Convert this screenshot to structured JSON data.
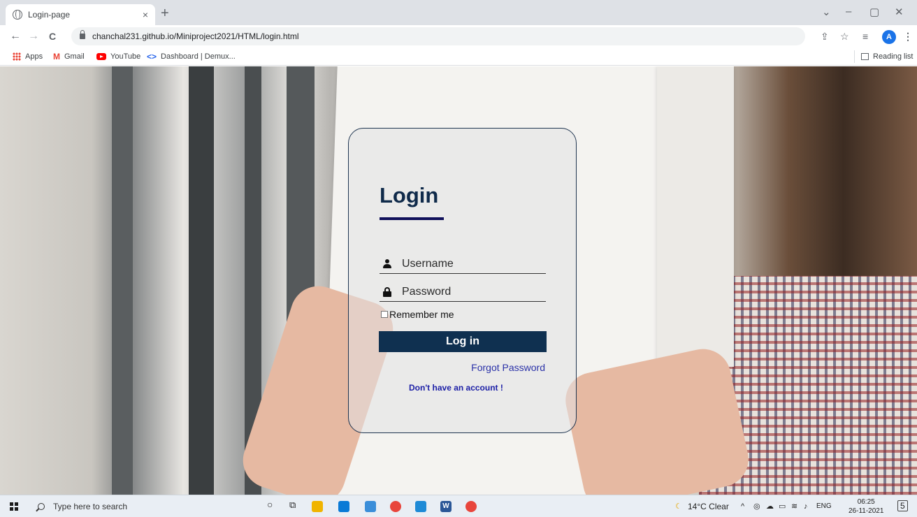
{
  "browser": {
    "tab_title": "Login-page",
    "tab_close": "×",
    "new_tab": "+",
    "url": "chanchal231.github.io/Miniproject2021/HTML/login.html",
    "profile_initial": "A",
    "window_controls": {
      "chevron": "⌄",
      "minimize": "–",
      "restore": "▢",
      "close": "✕"
    },
    "nav": {
      "back": "←",
      "forward": "→",
      "reload": "C"
    }
  },
  "bookmarks": {
    "items": [
      {
        "label": "Apps",
        "icon": "apps-grid-icon"
      },
      {
        "label": "Gmail",
        "icon": "gmail-icon"
      },
      {
        "label": "YouTube",
        "icon": "youtube-icon"
      },
      {
        "label": "Dashboard | Demux...",
        "icon": "demux-icon"
      }
    ],
    "reading_list": "Reading list"
  },
  "login": {
    "title": "Login",
    "username_placeholder": "Username",
    "password_placeholder": "Password",
    "remember_label": "Remember me",
    "login_button": "Log in",
    "forgot_link": "Forgot Password",
    "signup_link": "Don't have an account !"
  },
  "taskbar": {
    "search_placeholder": "Type here to search",
    "weather": "14°C  Clear",
    "language": "ENG",
    "time": "06:25",
    "date": "26-11-2021",
    "notifications": "5"
  },
  "colors": {
    "login_button_bg": "#0f3050",
    "title_color": "#0f2a4a",
    "link_color": "#2a31a8",
    "card_border": "#1f3550"
  }
}
